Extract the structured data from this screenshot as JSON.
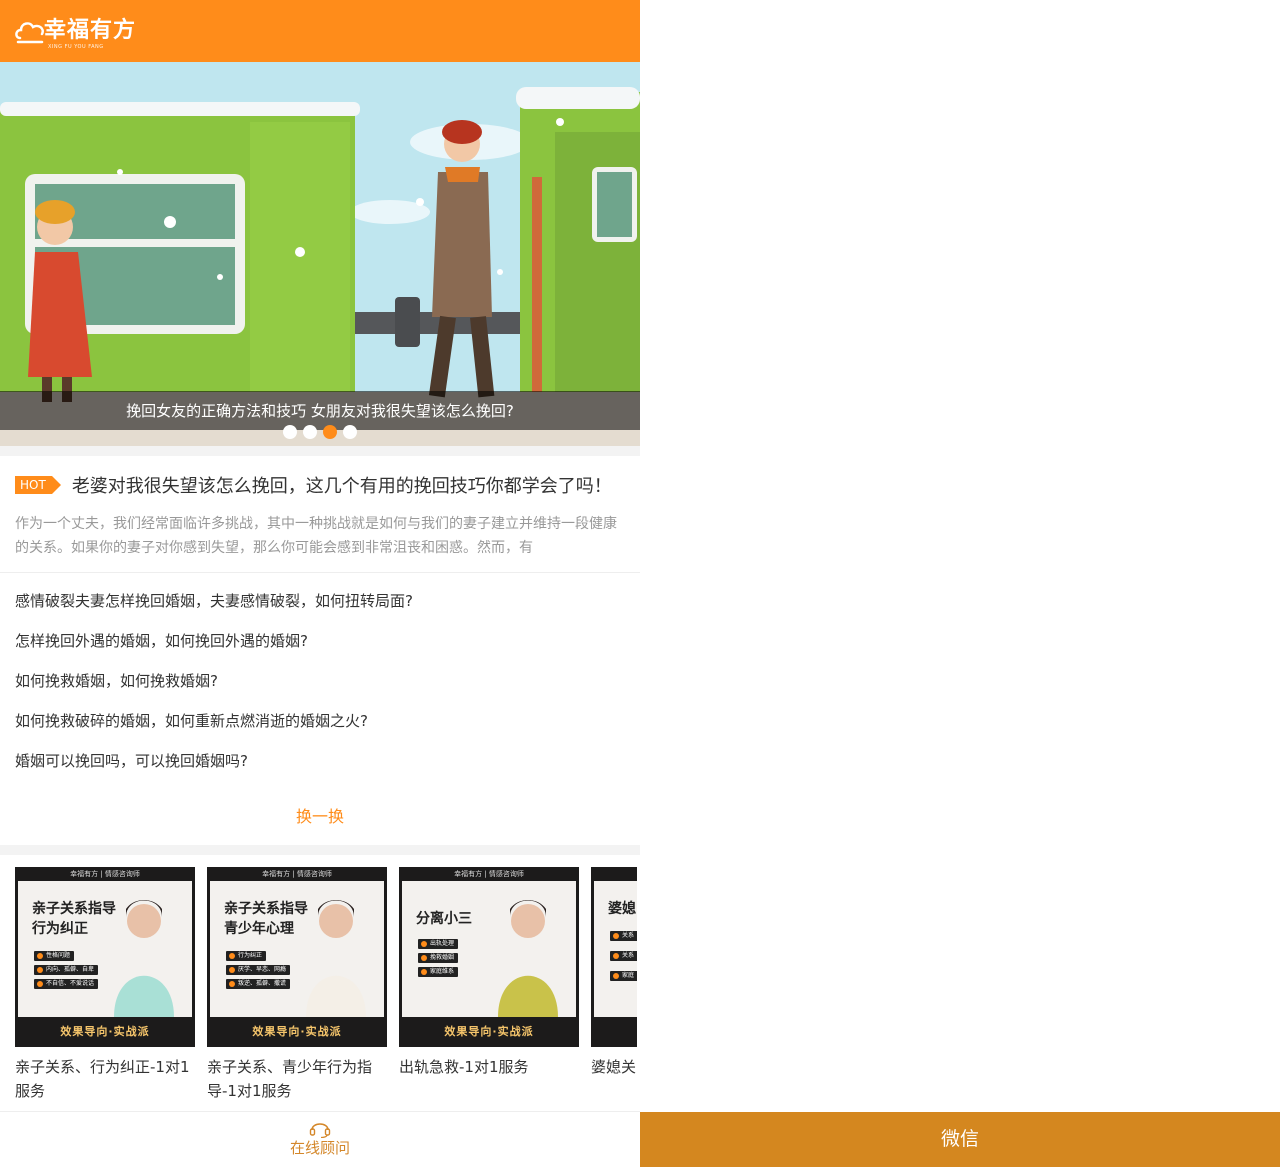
{
  "header": {
    "logo_text": "幸福有方",
    "logo_sub": "XING FU YOU FANG"
  },
  "banner": {
    "caption": "挽回女友的正确方法和技巧 女朋友对我很失望该怎么挽回?",
    "dot_count": 4,
    "active_dot": 2
  },
  "hot": {
    "tag": "HOT",
    "title": "老婆对我很失望该怎么挽回，这几个有用的挽回技巧你都学会了吗！",
    "desc": "作为一个丈夫，我们经常面临许多挑战，其中一种挑战就是如何与我们的妻子建立并维持一段健康的关系。如果你的妻子对你感到失望，那么你可能会感到非常沮丧和困惑。然而，有"
  },
  "list": [
    "感情破裂夫妻怎样挽回婚姻，夫妻感情破裂，如何扭转局面?",
    "怎样挽回外遇的婚姻，如何挽回外遇的婚姻?",
    "如何挽救婚姻，如何挽救婚姻?",
    "如何挽救破碎的婚姻，如何重新点燃消逝的婚姻之火?",
    "婚姻可以挽回吗，可以挽回婚姻吗?"
  ],
  "swap_label": "换一换",
  "services": [
    {
      "top": "幸福有方 | 情感咨询师",
      "headline_1": "亲子关系指导",
      "headline_2": "行为纠正",
      "chips": [
        "性格问题",
        "内向、孤僻、自卑",
        "不自信、不爱说话"
      ],
      "bottom": "效果导向·实战派",
      "name": "亲子关系、行为纠正-1对1服务"
    },
    {
      "top": "幸福有方 | 情感咨询师",
      "headline_1": "亲子关系指导",
      "headline_2": "青少年心理",
      "chips": [
        "行为纠正",
        "厌学、早恋、网瘾",
        "叛逆、孤僻、撒谎"
      ],
      "bottom": "效果导向·实战派",
      "name": "亲子关系、青少年行为指导-1对1服务"
    },
    {
      "top": "幸福有方 | 情感咨询师",
      "headline_1": "分离小三",
      "headline_2": "",
      "chips": [
        "出轨处理",
        "挽救婚姻",
        "家庭维系"
      ],
      "bottom": "效果导向·实战派",
      "name": "出轨急救-1对1服务"
    },
    {
      "top": "",
      "headline_1": "婆媳",
      "headline_2": "",
      "chips": [
        "关系",
        "关系",
        "家庭"
      ],
      "bottom": "",
      "name": "婆媳关"
    }
  ],
  "bottom_bar": {
    "advisor_label": "在线顾问",
    "wechat_label": "微信"
  },
  "colors": {
    "brand_orange": "#ff8c1a",
    "wechat_bar": "#d4871f"
  }
}
